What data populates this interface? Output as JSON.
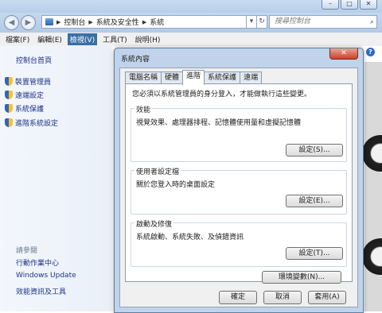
{
  "window": {
    "address_crumbs": [
      "控制台",
      "系統及安全性",
      "系統"
    ],
    "search_placeholder": "搜尋控制台",
    "controls": {
      "minimize": "–",
      "maximize": "□",
      "close": "✕"
    }
  },
  "menu": [
    {
      "label": "檔案(F)"
    },
    {
      "label": "編輯(E)"
    },
    {
      "label": "檢視(V)",
      "active": true
    },
    {
      "label": "工具(T)"
    },
    {
      "label": "說明(H)"
    }
  ],
  "sidebar": {
    "home": "控制台首頁",
    "links": [
      "裝置管理員",
      "遠端設定",
      "系統保護",
      "進階系統設定"
    ],
    "see_also_title": "請參閱",
    "see_also": [
      "行動作業中心",
      "Windows Update",
      "效能資訊及工具"
    ]
  },
  "dialog": {
    "title": "系統內容",
    "close": "✕",
    "tabs": [
      "電腦名稱",
      "硬體",
      "進階",
      "系統保護",
      "遠端"
    ],
    "selected_tab": "進階",
    "notice": "您必須以系統管理員的身分登入，才能做執行這些變更。",
    "groups": [
      {
        "title": "效能",
        "desc": "視覺效果、處理器排程、記憶體使用量和虛擬記憶體",
        "button": "設定(S)..."
      },
      {
        "title": "使用者設定檔",
        "desc": "關於您登入時的桌面設定",
        "button": "設定(E)..."
      },
      {
        "title": "啟動及修復",
        "desc": "系統啟動、系統失敗、及偵錯資訊",
        "button": "設定(T)..."
      }
    ],
    "env_button": "環境變數(N)...",
    "ok": "確定",
    "cancel": "取消",
    "apply": "套用(A)"
  },
  "colors": {
    "accent": "#3a6ea5",
    "link": "#1e3287",
    "dialog_frame": "#c0d3ea"
  }
}
